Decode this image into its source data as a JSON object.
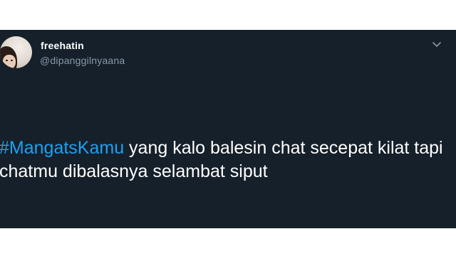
{
  "tweet": {
    "author": {
      "display_name": "freehatin",
      "handle": "@dipanggilnyaana"
    },
    "hashtag": "#MangatsKamu",
    "line1_rest": " yang kalo balesin chat secepat kilat tapi",
    "line2": "chatmu dibalasnya selambat siput",
    "menu_icon": "chevron-down-icon"
  },
  "colors": {
    "card_background": "#15202b",
    "text_primary": "#ffffff",
    "text_secondary": "#8899a6",
    "hashtag": "#1da1f2"
  }
}
